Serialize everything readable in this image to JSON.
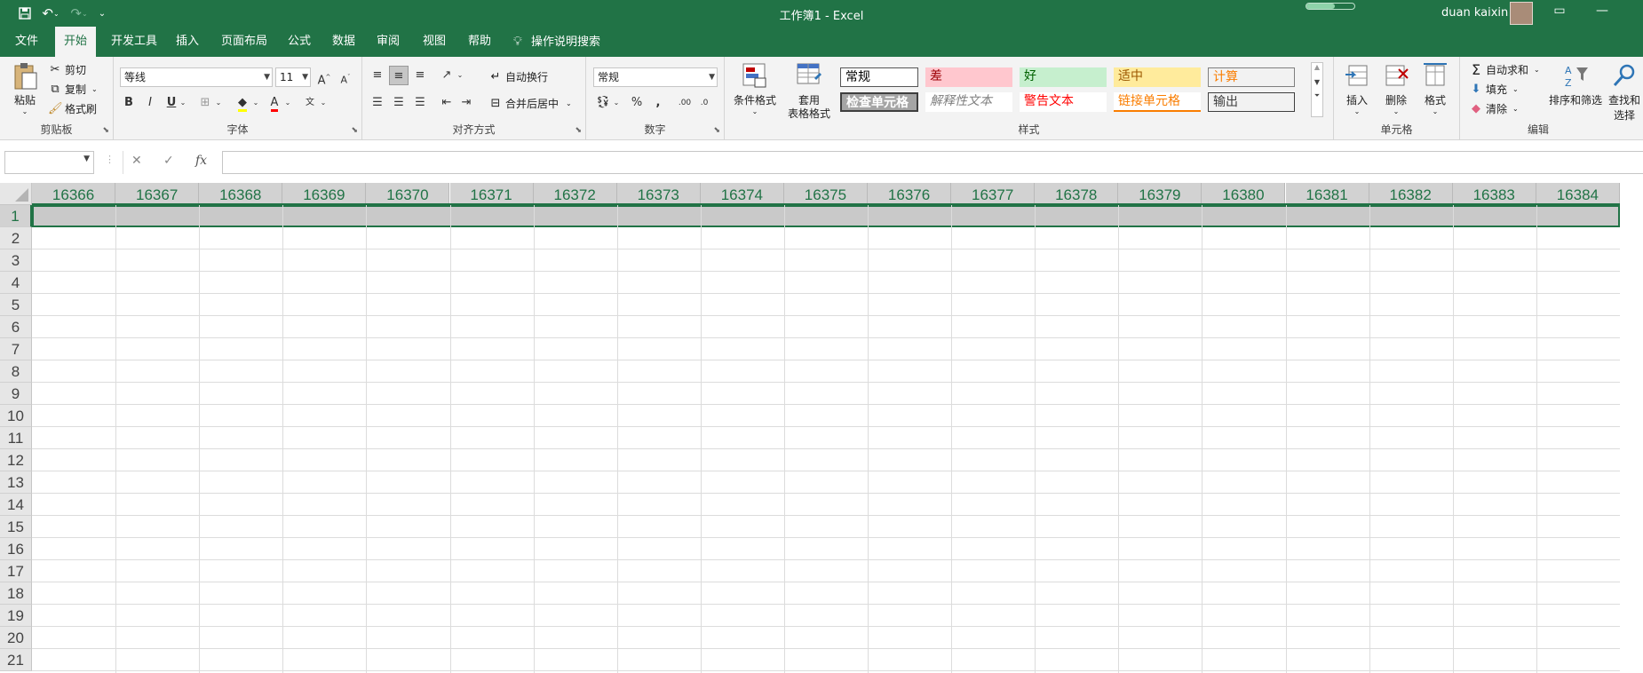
{
  "window": {
    "title": "工作簿1  -  Excel",
    "user": "duan kaixin"
  },
  "tabs": [
    "文件",
    "开始",
    "开发工具",
    "插入",
    "页面布局",
    "公式",
    "数据",
    "审阅",
    "视图",
    "帮助",
    "操作说明搜索"
  ],
  "active_tab": "开始",
  "ribbon": {
    "clipboard": {
      "label": "剪贴板",
      "paste": "粘贴",
      "cut": "剪切",
      "copy": "复制",
      "format_painter": "格式刷"
    },
    "font": {
      "label": "字体",
      "font_name": "等线",
      "font_size": "11"
    },
    "alignment": {
      "label": "对齐方式",
      "wrap_text": "自动换行",
      "merge_center": "合并后居中"
    },
    "number": {
      "label": "数字",
      "format": "常规"
    },
    "styles": {
      "label": "样式",
      "conditional_format": "条件格式",
      "table_format_line1": "套用",
      "table_format_line2": "表格格式",
      "cells": [
        {
          "text": "常规",
          "bg": "#ffffff",
          "fg": "#000000"
        },
        {
          "text": "差",
          "bg": "#ffc7ce",
          "fg": "#9c0006"
        },
        {
          "text": "好",
          "bg": "#c6efce",
          "fg": "#006100"
        },
        {
          "text": "适中",
          "bg": "#ffeb9c",
          "fg": "#9c5700"
        },
        {
          "text": "计算",
          "bg": "#f2f2f2",
          "fg": "#fa7d00"
        },
        {
          "text": "检查单元格",
          "bg": "#a5a5a5",
          "fg": "#ffffff"
        },
        {
          "text": "解释性文本",
          "bg": "#ffffff",
          "fg": "#7f7f7f"
        },
        {
          "text": "警告文本",
          "bg": "#ffffff",
          "fg": "#ff0000"
        },
        {
          "text": "链接单元格",
          "bg": "#ffffff",
          "fg": "#fa7d00"
        },
        {
          "text": "输出",
          "bg": "#f2f2f2",
          "fg": "#3f3f3f"
        }
      ]
    },
    "cells": {
      "label": "单元格",
      "insert": "插入",
      "delete": "删除",
      "format": "格式"
    },
    "editing": {
      "label": "编辑",
      "autosum": "自动求和",
      "fill": "填充",
      "clear": "清除",
      "sort_filter": "排序和筛选",
      "find_select": "查找和选择"
    }
  },
  "formula_bar": {
    "name_box": "",
    "formula": ""
  },
  "grid": {
    "columns": [
      "16366",
      "16367",
      "16368",
      "16369",
      "16370",
      "16371",
      "16372",
      "16373",
      "16374",
      "16375",
      "16376",
      "16377",
      "16378",
      "16379",
      "16380",
      "16381",
      "16382",
      "16383",
      "16384"
    ],
    "rows": [
      "1",
      "2",
      "3",
      "4",
      "5",
      "6",
      "7",
      "8",
      "9",
      "10",
      "11",
      "12",
      "13",
      "14",
      "15",
      "16",
      "17",
      "18",
      "19",
      "20",
      "21"
    ],
    "selected_row": "1"
  },
  "colors": {
    "accent": "#217346",
    "header_selected": "#d2d2d2",
    "row_selected": "#c9c9c9"
  }
}
